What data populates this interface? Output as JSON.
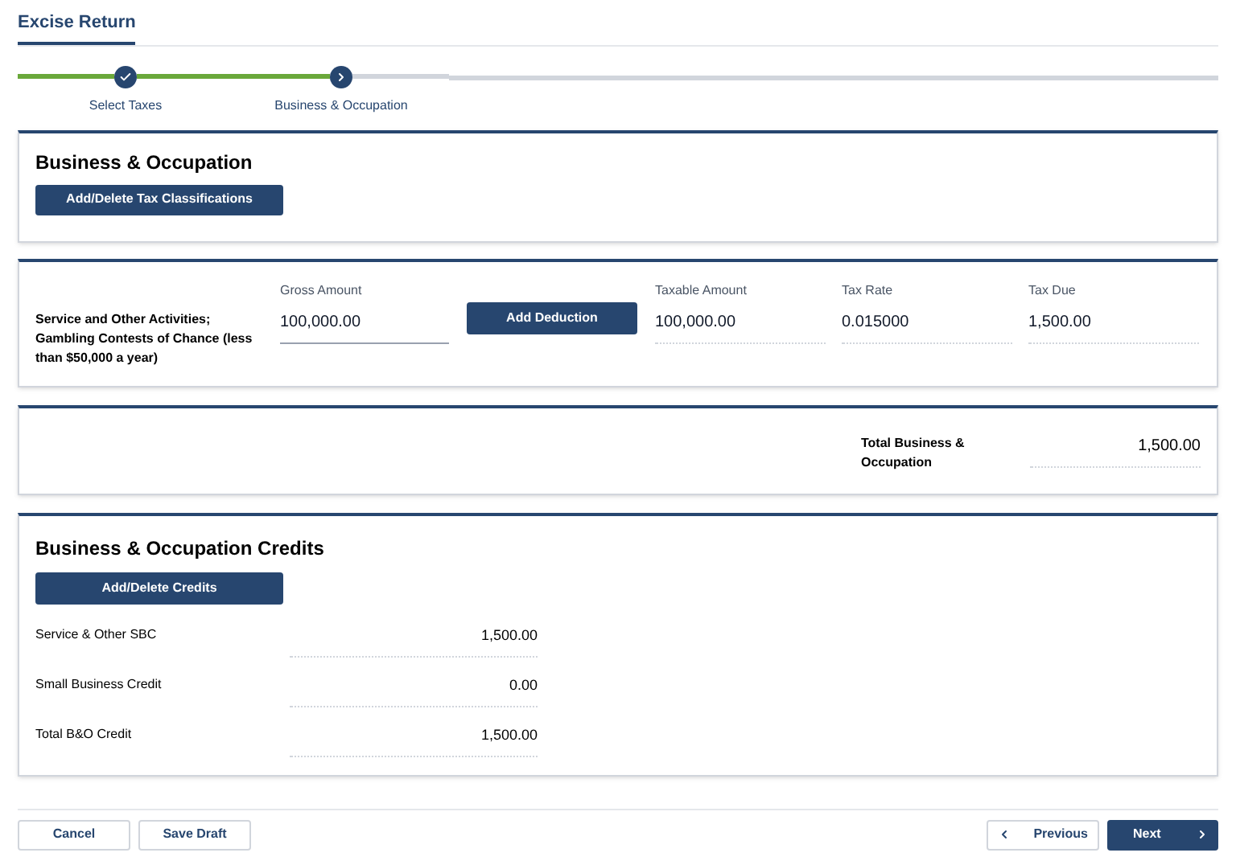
{
  "header": {
    "title": "Excise Return"
  },
  "steps": [
    {
      "label": "Select Taxes",
      "completed": true
    },
    {
      "label": "Business & Occupation",
      "completed": false
    }
  ],
  "bo_section": {
    "title": "Business & Occupation",
    "button": "Add/Delete Tax Classifications"
  },
  "line_item": {
    "label": "Service and Other Activities; Gambling Contests of Chance (less than $50,000 a year)",
    "gross": {
      "label": "Gross Amount",
      "value": "100,000.00"
    },
    "button": "Add Deduction",
    "fields": [
      {
        "label": "Taxable Amount",
        "value": "100,000.00"
      },
      {
        "label": "Tax Rate",
        "value": "0.015000"
      },
      {
        "label": "Tax Due",
        "value": "1,500.00"
      }
    ]
  },
  "total": {
    "label": "Total Business & Occupation",
    "value": "1,500.00"
  },
  "credits": {
    "title": "Business & Occupation Credits",
    "button": "Add/Delete Credits",
    "rows": [
      {
        "label": "Service & Other SBC",
        "value": "1,500.00"
      },
      {
        "label": "Small Business Credit",
        "value": "0.00"
      },
      {
        "label": "Total B&O Credit",
        "value": "1,500.00"
      }
    ]
  },
  "footer": {
    "cancel": "Cancel",
    "save": "Save Draft",
    "previous": "Previous",
    "next": "Next"
  }
}
